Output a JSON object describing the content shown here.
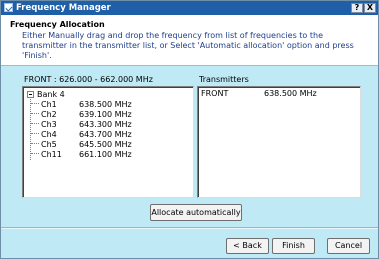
{
  "window": {
    "title": "Frequency Manager",
    "help_label": "?",
    "close_label": "X"
  },
  "header": {
    "title": "Frequency Allocation",
    "description": "Either Manually drag and drop the frequency from list of frequencies to the transmitter in the transmitter list, or Select 'Automatic allocation' option and press 'Finish'."
  },
  "frequency_list": {
    "range_label": "FRONT : 626.000 - 662.000 MHz",
    "bank_label": "Bank 4",
    "channels": [
      {
        "name": "Ch1",
        "freq": "638.500  MHz"
      },
      {
        "name": "Ch2",
        "freq": "639.100  MHz"
      },
      {
        "name": "Ch3",
        "freq": "643.300  MHz"
      },
      {
        "name": "Ch4",
        "freq": "643.700  MHz"
      },
      {
        "name": "Ch5",
        "freq": "645.500  MHz"
      },
      {
        "name": "Ch11",
        "freq": "661.100  MHz"
      }
    ]
  },
  "transmitters": {
    "label": "Transmitters",
    "rows": [
      {
        "name": "FRONT",
        "freq": "638.500  MHz"
      }
    ]
  },
  "buttons": {
    "allocate": "Allocate automatically",
    "back": "< Back",
    "finish": "Finish",
    "cancel": "Cancel"
  },
  "icons": {
    "app": "frequency-manager-icon",
    "expander": "tree-collapse-icon"
  },
  "colors": {
    "titlebar": "#1f5fa8",
    "dialog_background": "#bfe9f5",
    "description_text": "#1f3f8a"
  }
}
